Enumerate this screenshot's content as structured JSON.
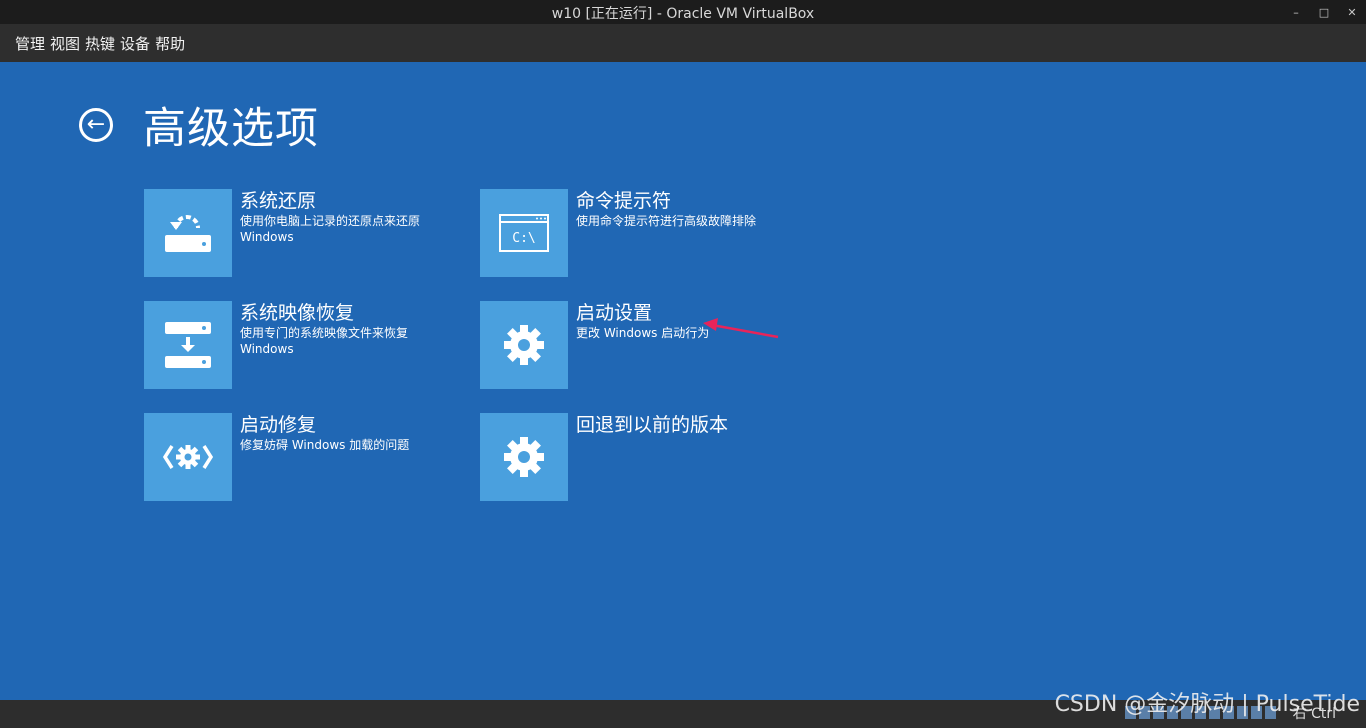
{
  "window": {
    "title": "w10 [正在运行] - Oracle VM VirtualBox"
  },
  "menu": [
    "管理",
    "视图",
    "热键",
    "设备",
    "帮助"
  ],
  "page": {
    "title": "高级选项",
    "options": [
      {
        "label": "系统还原",
        "desc": "使用你电脑上记录的还原点来还原 Windows",
        "icon": "system-restore-icon"
      },
      {
        "label": "命令提示符",
        "desc": "使用命令提示符进行高级故障排除",
        "icon": "command-prompt-icon"
      },
      {
        "label": "系统映像恢复",
        "desc": "使用专门的系统映像文件来恢复 Windows",
        "icon": "image-recovery-icon"
      },
      {
        "label": "启动设置",
        "desc": "更改 Windows 启动行为",
        "icon": "gear-icon"
      },
      {
        "label": "启动修复",
        "desc": "修复妨碍 Windows 加载的问题",
        "icon": "startup-repair-icon"
      },
      {
        "label": "回退到以前的版本",
        "desc": "",
        "icon": "gear-icon"
      }
    ]
  },
  "status": {
    "host_key": "右 Ctrl"
  },
  "watermark": "CSDN @金汐脉动 | PulseTide"
}
